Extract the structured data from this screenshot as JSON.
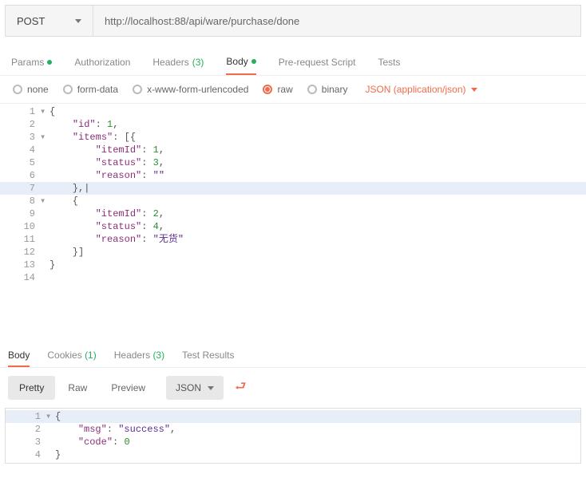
{
  "request": {
    "method": "POST",
    "url": "http://localhost:88/api/ware/purchase/done"
  },
  "tabs": {
    "params": "Params",
    "authorization": "Authorization",
    "headers": "Headers",
    "headers_count": "(3)",
    "body": "Body",
    "prerequest": "Pre-request Script",
    "tests": "Tests"
  },
  "body_options": {
    "none": "none",
    "formdata": "form-data",
    "xwww": "x-www-form-urlencoded",
    "raw": "raw",
    "binary": "binary",
    "content_type": "JSON (application/json)"
  },
  "request_body_lines": [
    {
      "n": 1,
      "fold": "▾",
      "code": [
        {
          "t": "brace",
          "v": "{"
        }
      ],
      "hl": false
    },
    {
      "n": 2,
      "fold": "",
      "code": [
        {
          "t": "plain",
          "v": "    "
        },
        {
          "t": "key",
          "v": "\"id\""
        },
        {
          "t": "plain",
          "v": ": "
        },
        {
          "t": "num",
          "v": "1"
        },
        {
          "t": "plain",
          "v": ","
        }
      ],
      "hl": false
    },
    {
      "n": 3,
      "fold": "▾",
      "code": [
        {
          "t": "plain",
          "v": "    "
        },
        {
          "t": "key",
          "v": "\"items\""
        },
        {
          "t": "plain",
          "v": ": [{"
        }
      ],
      "hl": false
    },
    {
      "n": 4,
      "fold": "",
      "code": [
        {
          "t": "plain",
          "v": "        "
        },
        {
          "t": "key",
          "v": "\"itemId\""
        },
        {
          "t": "plain",
          "v": ": "
        },
        {
          "t": "num",
          "v": "1"
        },
        {
          "t": "plain",
          "v": ","
        }
      ],
      "hl": false
    },
    {
      "n": 5,
      "fold": "",
      "code": [
        {
          "t": "plain",
          "v": "        "
        },
        {
          "t": "key",
          "v": "\"status\""
        },
        {
          "t": "plain",
          "v": ": "
        },
        {
          "t": "num",
          "v": "3"
        },
        {
          "t": "plain",
          "v": ","
        }
      ],
      "hl": false
    },
    {
      "n": 6,
      "fold": "",
      "code": [
        {
          "t": "plain",
          "v": "        "
        },
        {
          "t": "key",
          "v": "\"reason\""
        },
        {
          "t": "plain",
          "v": ": "
        },
        {
          "t": "str",
          "v": "\"\""
        }
      ],
      "hl": false
    },
    {
      "n": 7,
      "fold": "",
      "code": [
        {
          "t": "plain",
          "v": "    },|"
        }
      ],
      "hl": true
    },
    {
      "n": 8,
      "fold": "▾",
      "code": [
        {
          "t": "plain",
          "v": "    {"
        }
      ],
      "hl": false
    },
    {
      "n": 9,
      "fold": "",
      "code": [
        {
          "t": "plain",
          "v": "        "
        },
        {
          "t": "key",
          "v": "\"itemId\""
        },
        {
          "t": "plain",
          "v": ": "
        },
        {
          "t": "num",
          "v": "2"
        },
        {
          "t": "plain",
          "v": ","
        }
      ],
      "hl": false
    },
    {
      "n": 10,
      "fold": "",
      "code": [
        {
          "t": "plain",
          "v": "        "
        },
        {
          "t": "key",
          "v": "\"status\""
        },
        {
          "t": "plain",
          "v": ": "
        },
        {
          "t": "num",
          "v": "4"
        },
        {
          "t": "plain",
          "v": ","
        }
      ],
      "hl": false
    },
    {
      "n": 11,
      "fold": "",
      "code": [
        {
          "t": "plain",
          "v": "        "
        },
        {
          "t": "key",
          "v": "\"reason\""
        },
        {
          "t": "plain",
          "v": ": "
        },
        {
          "t": "str",
          "v": "\"无货\""
        }
      ],
      "hl": false
    },
    {
      "n": 12,
      "fold": "",
      "code": [
        {
          "t": "plain",
          "v": "    }]"
        }
      ],
      "hl": false
    },
    {
      "n": 13,
      "fold": "",
      "code": [
        {
          "t": "brace",
          "v": "}"
        }
      ],
      "hl": false
    },
    {
      "n": 14,
      "fold": "",
      "code": [
        {
          "t": "plain",
          "v": ""
        }
      ],
      "hl": false
    }
  ],
  "response_tabs": {
    "body": "Body",
    "cookies": "Cookies",
    "cookies_count": "(1)",
    "headers": "Headers",
    "headers_count": "(3)",
    "tests": "Test Results"
  },
  "response_toolbar": {
    "pretty": "Pretty",
    "raw": "Raw",
    "preview": "Preview",
    "format": "JSON"
  },
  "response_body_lines": [
    {
      "n": 1,
      "fold": "▾",
      "code": [
        {
          "t": "brace",
          "v": "{"
        }
      ],
      "hl": true
    },
    {
      "n": 2,
      "fold": "",
      "code": [
        {
          "t": "plain",
          "v": "    "
        },
        {
          "t": "key",
          "v": "\"msg\""
        },
        {
          "t": "plain",
          "v": ": "
        },
        {
          "t": "str",
          "v": "\"success\""
        },
        {
          "t": "plain",
          "v": ","
        }
      ],
      "hl": false
    },
    {
      "n": 3,
      "fold": "",
      "code": [
        {
          "t": "plain",
          "v": "    "
        },
        {
          "t": "key",
          "v": "\"code\""
        },
        {
          "t": "plain",
          "v": ": "
        },
        {
          "t": "num",
          "v": "0"
        }
      ],
      "hl": false
    },
    {
      "n": 4,
      "fold": "",
      "code": [
        {
          "t": "brace",
          "v": "}"
        }
      ],
      "hl": false
    }
  ]
}
